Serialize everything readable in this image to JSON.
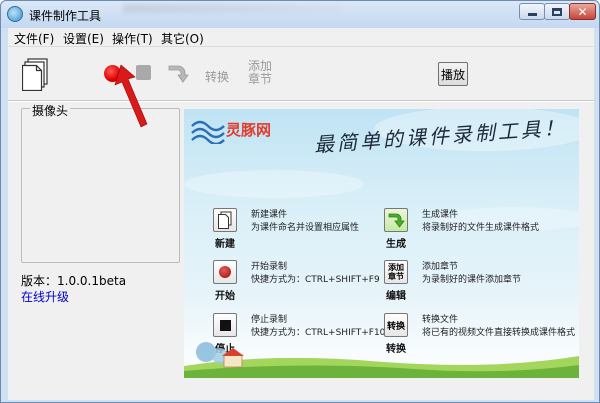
{
  "window": {
    "title": "课件制作工具",
    "colors": {
      "frame": "#cfe0f3",
      "record": "#e00000",
      "link": "#0000d0",
      "logo": "#e23c2c"
    }
  },
  "menu": [
    {
      "label": "文件(F)"
    },
    {
      "label": "设置(E)"
    },
    {
      "label": "操作(T)"
    },
    {
      "label": "其它(O)"
    }
  ],
  "toolbar": {
    "new_icon": "new-document-icon",
    "record_icon": "record-icon",
    "stop_icon": "stop-icon",
    "convert_icon": "convert-arrow-icon",
    "convert_label": "转换",
    "add_chapter_label": "添加章节",
    "play_label": "播放"
  },
  "camera": {
    "legend": "摄像头"
  },
  "version": {
    "label": "版本：1.0.0.1beta",
    "upgrade_link": "在线升级"
  },
  "banner": {
    "logo_text": "灵豚网",
    "slogan": "最简单的课件录制工具！",
    "features": [
      {
        "icon": "new-document-icon",
        "caption": "新建",
        "title": "新建课件",
        "desc": "为课件命名并设置相应属性"
      },
      {
        "icon": "generate-arrow-icon",
        "caption": "生成",
        "title": "生成课件",
        "desc": "将录制好的文件生成课件格式"
      },
      {
        "icon": "record-icon",
        "caption": "开始",
        "title": "开始录制",
        "desc": "快捷方式为：CTRL+SHIFT+F9"
      },
      {
        "icon": "add-chapter-icon",
        "icon_text": "添加章节",
        "caption": "编辑",
        "title": "添加章节",
        "desc": "为录制好的课件添加章节"
      },
      {
        "icon": "stop-icon",
        "caption": "停止",
        "title": "停止录制",
        "desc": "快捷方式为：CTRL+SHIFT+F10"
      },
      {
        "icon": "convert-icon",
        "icon_text": "转换",
        "caption": "转换",
        "title": "转换文件",
        "desc": "将已有的视频文件直接转换成课件格式"
      }
    ]
  }
}
